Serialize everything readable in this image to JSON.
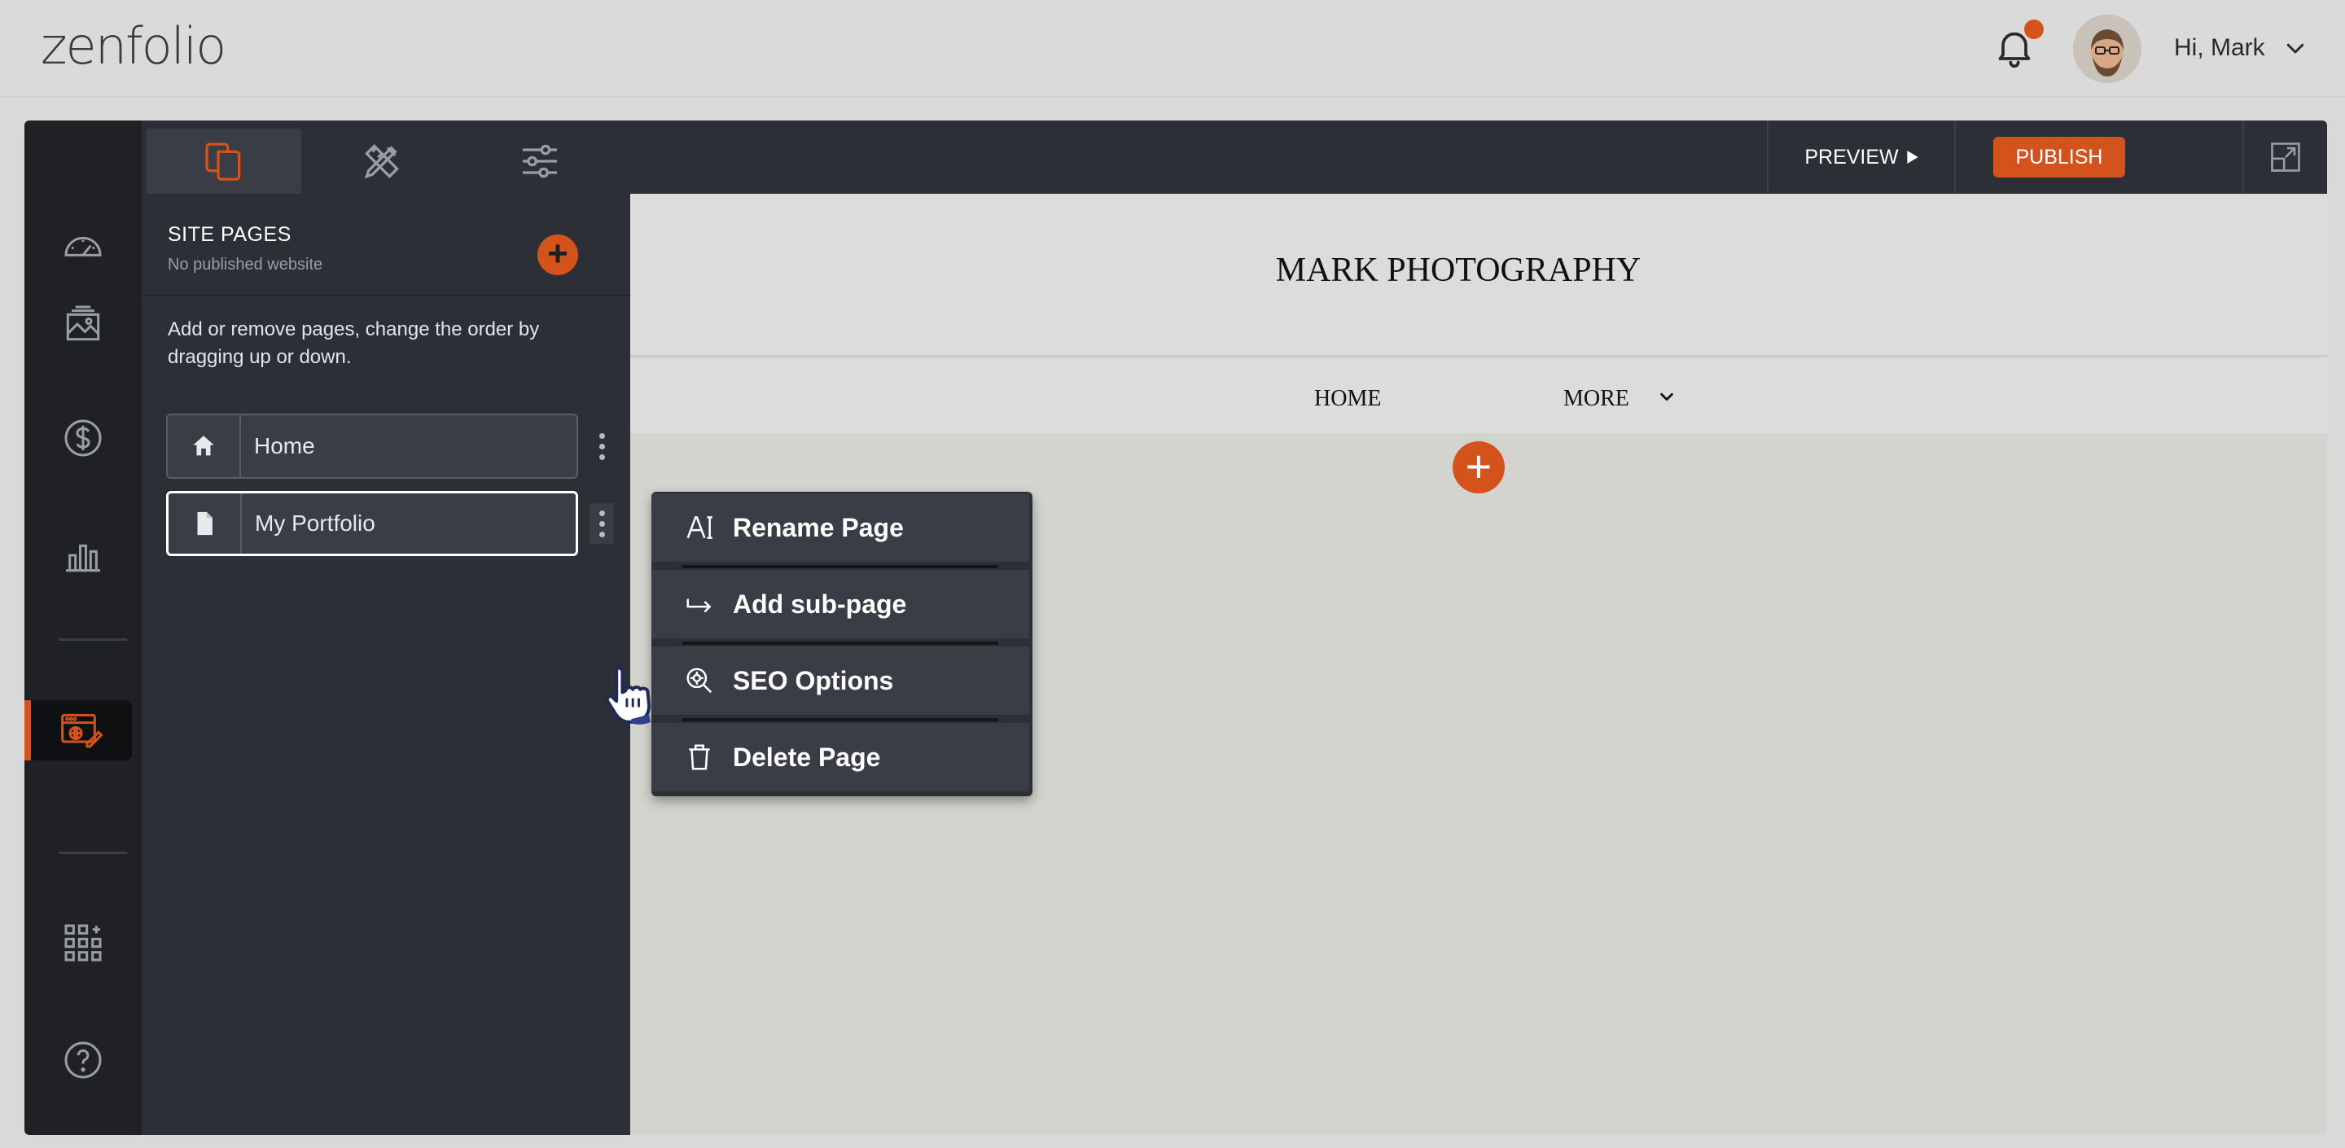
{
  "header": {
    "logo": "zenfolio",
    "greeting": "Hi, Mark",
    "icons": [
      "bell-icon",
      "avatar",
      "chevron-down-icon"
    ]
  },
  "rail": {
    "items": [
      "dashboard-icon",
      "gallery-icon",
      "dollar-icon",
      "bar-chart-icon",
      "website-editor-icon",
      "apps-grid-icon",
      "help-icon"
    ],
    "active": "website-editor-icon"
  },
  "panel": {
    "tabs": [
      "pages-icon",
      "design-tools-icon",
      "settings-sliders-icon"
    ],
    "title": "SITE PAGES",
    "subtitle": "No published website",
    "description": "Add or remove pages, change the order by dragging up or down.",
    "pages": [
      {
        "label": "Home",
        "icon": "home-icon"
      },
      {
        "label": "My Portfolio",
        "icon": "page-icon"
      }
    ]
  },
  "toolbar": {
    "preview_label": "PREVIEW",
    "publish_label": "PUBLISH"
  },
  "site": {
    "title": "MARK PHOTOGRAPHY",
    "nav": [
      "HOME",
      "MORE"
    ]
  },
  "context_menu": {
    "items": [
      {
        "label": "Rename Page",
        "icon": "rename-icon"
      },
      {
        "label": "Add sub-page",
        "icon": "subpage-arrow-icon"
      },
      {
        "label": "SEO Options",
        "icon": "seo-search-icon"
      },
      {
        "label": "Delete Page",
        "icon": "trash-icon"
      }
    ]
  },
  "colors": {
    "accent": "#d4531c",
    "rail_bg": "#1f2125",
    "panel_bg": "#2c2f36",
    "menu_item_bg": "#3a3d45"
  }
}
